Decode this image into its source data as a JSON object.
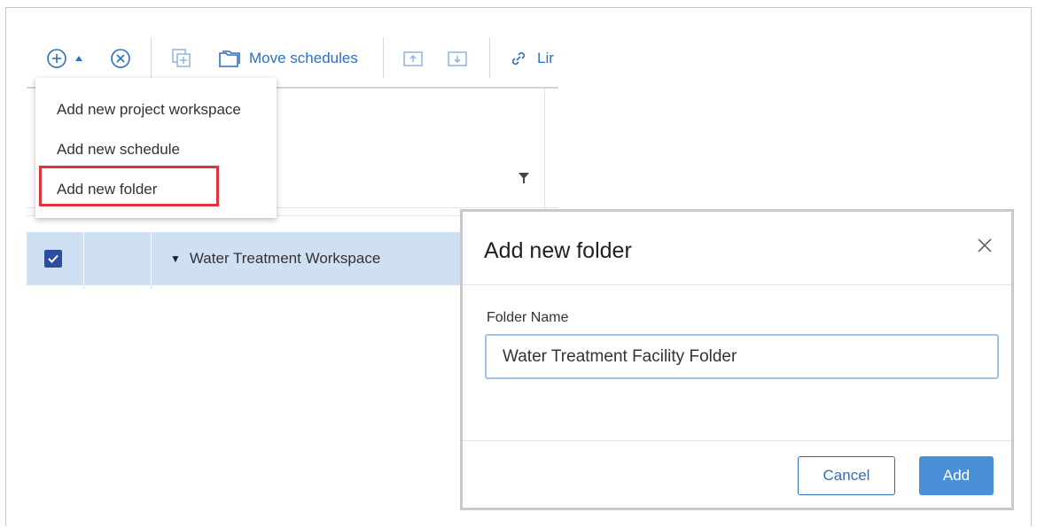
{
  "toolbar": {
    "add_icon": "circle-plus-icon",
    "caret_icon": "caret-up-icon",
    "remove_icon": "circle-x-icon",
    "copy_icon": "copy-plus-icon",
    "move_label": "Move schedules",
    "link_label": "Lir"
  },
  "dropdown": {
    "items": [
      "Add new project workspace",
      "Add new schedule",
      "Add new folder"
    ],
    "highlight_color": "#e0343c"
  },
  "grid": {
    "row": {
      "checked": true,
      "label": "Water Treatment Workspace"
    }
  },
  "dialog": {
    "title": "Add new folder",
    "field_label": "Folder Name",
    "field_value": "Water Treatment Facility Folder",
    "cancel_label": "Cancel",
    "add_label": "Add"
  },
  "colors": {
    "accent": "#2f6fbf",
    "primary_button": "#4a90d9",
    "row_selected": "#cfe0f3",
    "checkbox": "#2a4fa1"
  }
}
